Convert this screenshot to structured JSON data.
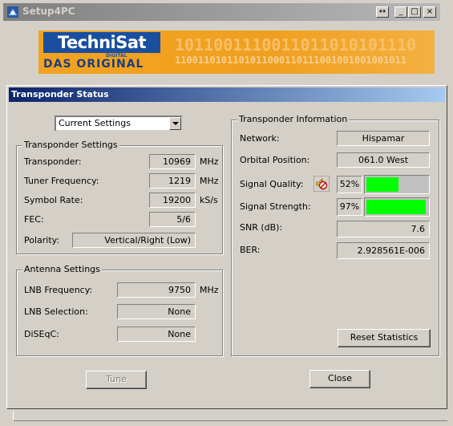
{
  "window": {
    "title": "Setup4PC",
    "restore_label": "↔",
    "min_label": "_",
    "max_label": "□",
    "close_label": "×"
  },
  "banner": {
    "logo_main": "TechniSat",
    "logo_digital": "DIGITAL",
    "logo_sub": "DAS ORIGINAL",
    "binary_row1": "1011001110011011010101110",
    "binary_row2": "1100110101101011000110111001001001001011"
  },
  "dialog": {
    "title": "Transponder Status",
    "settings_select": "Current Settings",
    "transponder_settings": {
      "heading": "Transponder Settings",
      "transponder_label": "Transponder:",
      "transponder_value": "10969",
      "transponder_unit": "MHz",
      "tuner_label": "Tuner Frequency:",
      "tuner_value": "1219",
      "tuner_unit": "MHz",
      "symbol_label": "Symbol Rate:",
      "symbol_value": "19200",
      "symbol_unit": "kS/s",
      "fec_label": "FEC:",
      "fec_value": "5/6",
      "polarity_label": "Polarity:",
      "polarity_value": "Vertical/Right (Low)"
    },
    "antenna_settings": {
      "heading": "Antenna Settings",
      "lnb_freq_label": "LNB Frequency:",
      "lnb_freq_value": "9750",
      "lnb_freq_unit": "MHz",
      "lnb_sel_label": "LNB Selection:",
      "lnb_sel_value": "None",
      "diseqc_label": "DiSEqC:",
      "diseqc_value": "None"
    },
    "transponder_info": {
      "heading": "Transponder Information",
      "network_label": "Network:",
      "network_value": "Hispamar",
      "orbital_label": "Orbital Position:",
      "orbital_value": "061.0 West",
      "quality_label": "Signal Quality:",
      "quality_value": "52%",
      "quality_fraction": 0.52,
      "strength_label": "Signal Strength:",
      "strength_value": "97%",
      "strength_fraction": 0.97,
      "snr_label": "SNR (dB):",
      "snr_value": "7.6",
      "ber_label": "BER:",
      "ber_value": "2.928561E-006",
      "reset_label": "Reset Statistics"
    },
    "tune_label": "Tune",
    "close_label": "Close"
  },
  "colors": {
    "bar_fill": "#00ff00",
    "title_active": "#0a246a",
    "banner": "#f3a21f"
  }
}
